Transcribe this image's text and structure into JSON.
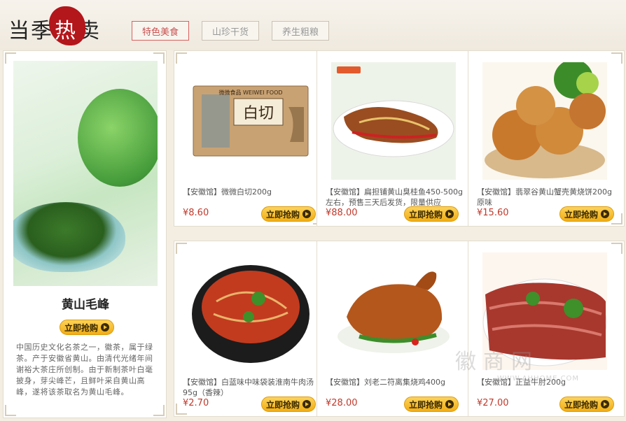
{
  "header": {
    "logo_text": "当季",
    "logo_hot": "热",
    "logo_end": "卖",
    "tabs": [
      {
        "label": "特色美食",
        "active": true
      },
      {
        "label": "山珍干货",
        "active": false
      },
      {
        "label": "养生粗粮",
        "active": false
      }
    ]
  },
  "feature": {
    "title": "黄山毛峰",
    "buy_label": "立即抢购",
    "description": "中国历史文化名茶之一，徽茶，属于绿茶。产于安徽省黄山。由清代光绪年间谢裕大茶庄所创制。由于新制茶叶白毫披身，芽尖峰芒，且鲜叶采自黄山高峰，遂将该茶取名为黄山毛峰。"
  },
  "products": [
    {
      "name": "【安徽馆】微微白切200g",
      "price": "¥8.60",
      "buy_label": "立即抢购",
      "image_text": "白切",
      "brand_text": "微微食品 WEIWEI FOOD"
    },
    {
      "name": "【安徽馆】扁担铺黄山臭桂鱼450-500g左右，预售三天后发货，限量供应",
      "price": "¥88.00",
      "buy_label": "立即抢购",
      "image_text": "",
      "brand_text": ""
    },
    {
      "name": "【安徽馆】翡翠谷黄山蟹壳黄烧饼200g原味",
      "price": "¥15.60",
      "buy_label": "立即抢购",
      "image_text": "",
      "brand_text": ""
    },
    {
      "name": "【安徽馆】白蓝味中味袋装淮南牛肉汤95g（香辣）",
      "price": "¥2.70",
      "buy_label": "立即抢购",
      "image_text": "",
      "brand_text": ""
    },
    {
      "name": "【安徽馆】刘老二符离集烧鸡400g",
      "price": "¥28.00",
      "buy_label": "立即抢购",
      "image_text": "",
      "brand_text": ""
    },
    {
      "name": "【安徽馆】正益牛肘200g",
      "price": "¥27.00",
      "buy_label": "立即抢购",
      "image_text": "",
      "brand_text": ""
    }
  ],
  "watermark": {
    "text": "徽商网",
    "url": "WWW.AHHOME.COM"
  },
  "colors": {
    "accent": "#b3161b",
    "price": "#c0392b",
    "button": "#f4c034"
  }
}
